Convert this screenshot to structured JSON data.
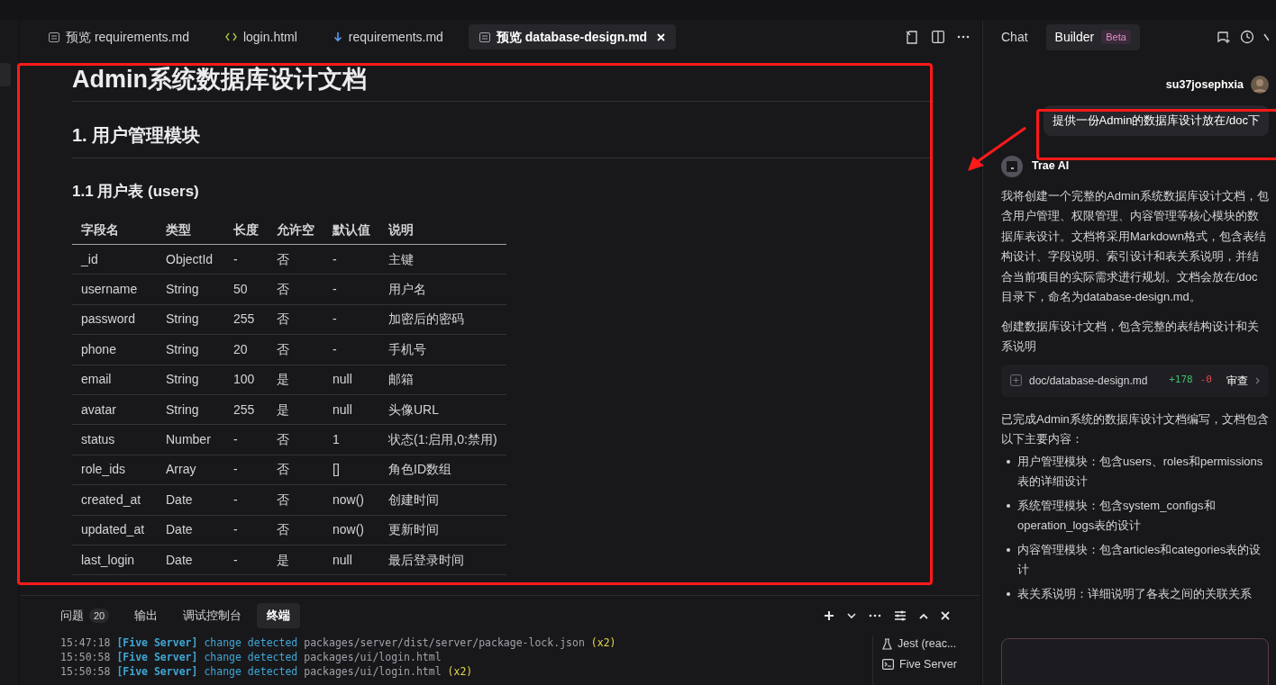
{
  "editor_tabs": [
    {
      "label": "预览 requirements.md",
      "kind": "preview",
      "selected": false
    },
    {
      "label": "login.html",
      "kind": "html",
      "selected": false
    },
    {
      "label": "requirements.md",
      "kind": "markdown",
      "selected": false
    },
    {
      "label": "预览 database-design.md",
      "kind": "preview",
      "selected": true
    }
  ],
  "document": {
    "title": "Admin系统数据库设计文档",
    "section": "1. 用户管理模块",
    "subsection": "1.1 用户表 (users)",
    "table": {
      "columns": [
        "字段名",
        "类型",
        "长度",
        "允许空",
        "默认值",
        "说明"
      ],
      "rows": [
        [
          "_id",
          "ObjectId",
          "-",
          "否",
          "-",
          "主键"
        ],
        [
          "username",
          "String",
          "50",
          "否",
          "-",
          "用户名"
        ],
        [
          "password",
          "String",
          "255",
          "否",
          "-",
          "加密后的密码"
        ],
        [
          "phone",
          "String",
          "20",
          "否",
          "-",
          "手机号"
        ],
        [
          "email",
          "String",
          "100",
          "是",
          "null",
          "邮箱"
        ],
        [
          "avatar",
          "String",
          "255",
          "是",
          "null",
          "头像URL"
        ],
        [
          "status",
          "Number",
          "-",
          "否",
          "1",
          "状态(1:启用,0:禁用)"
        ],
        [
          "role_ids",
          "Array",
          "-",
          "否",
          "[]",
          "角色ID数组"
        ],
        [
          "created_at",
          "Date",
          "-",
          "否",
          "now()",
          "创建时间"
        ],
        [
          "updated_at",
          "Date",
          "-",
          "否",
          "now()",
          "更新时间"
        ],
        [
          "last_login",
          "Date",
          "-",
          "是",
          "null",
          "最后登录时间"
        ]
      ]
    }
  },
  "panel": {
    "tabs": [
      {
        "label": "问题",
        "count": "20",
        "selected": false
      },
      {
        "label": "输出",
        "selected": false
      },
      {
        "label": "调试控制台",
        "selected": false
      },
      {
        "label": "终端",
        "selected": true
      }
    ],
    "terminal_lines": [
      [
        {
          "text": "15:47:18",
          "kind": "time"
        },
        {
          "text": "[Five Server]",
          "kind": "tag"
        },
        {
          "text": "change detected",
          "kind": "event"
        },
        {
          "text": "packages/server/dist/server/package-lock.json",
          "kind": "path"
        },
        {
          "text": "(x2)",
          "kind": "count"
        }
      ],
      [
        {
          "text": "15:50:58",
          "kind": "time"
        },
        {
          "text": "[Five Server]",
          "kind": "tag"
        },
        {
          "text": "change detected",
          "kind": "event"
        },
        {
          "text": "packages/ui/login.html",
          "kind": "path"
        }
      ],
      [
        {
          "text": "15:50:58",
          "kind": "time"
        },
        {
          "text": "[Five Server]",
          "kind": "tag"
        },
        {
          "text": "change detected",
          "kind": "event"
        },
        {
          "text": "packages/ui/login.html",
          "kind": "path"
        },
        {
          "text": "(x2)",
          "kind": "count"
        }
      ]
    ],
    "terminals": [
      {
        "label": "Jest (reac...",
        "kind": "test"
      },
      {
        "label": "Five Server",
        "kind": "shell"
      }
    ]
  },
  "chat": {
    "tabs": [
      {
        "label": "Chat",
        "selected": false
      },
      {
        "label": "Builder",
        "badge": "Beta",
        "selected": true
      }
    ],
    "user": "su37josephxia",
    "prompt": "提供一份Admin的数据库设计放在/doc下",
    "assistant": "Trae AI",
    "messages": [
      "我将创建一个完整的Admin系统数据库设计文档，包含用户管理、权限管理、内容管理等核心模块的数据库表设计。文档将采用Markdown格式，包含表结构设计、字段说明、索引设计和表关系说明，并结合当前项目的实际需求进行规划。文档会放在/doc目录下，命名为database-design.md。",
      "创建数据库设计文档，包含完整的表结构设计和关系说明"
    ],
    "file_change": {
      "path": "doc/database-design.md",
      "added": "+178",
      "removed": "-0",
      "action": "审查"
    },
    "summary": "已完成Admin系统的数据库设计文档编写，文档包含以下主要内容：",
    "bullets": [
      "用户管理模块：包含users、roles和permissions表的详细设计",
      "系统管理模块：包含system_configs和operation_logs表的设计",
      "内容管理模块：包含articles和categories表的设计",
      "表关系说明：详细说明了各表之间的关联关系"
    ]
  }
}
